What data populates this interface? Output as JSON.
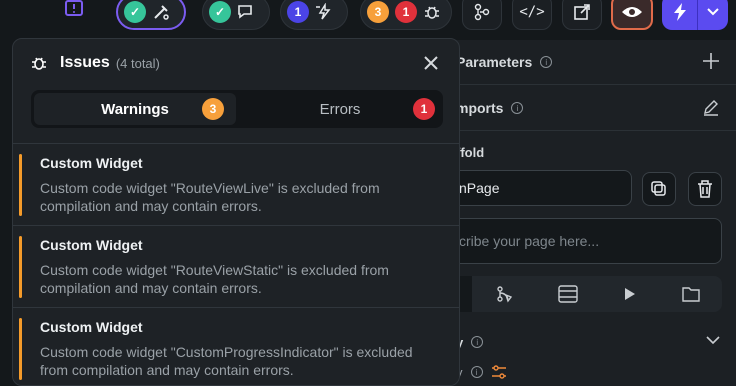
{
  "toolbar": {
    "pill_build": {
      "icons": [
        "check-icon",
        "magic-icon"
      ]
    },
    "pill_comments": {
      "icons": [
        "check-icon",
        "chat-icon"
      ]
    },
    "pill_actions": {
      "count": "1"
    },
    "pill_issues": {
      "warnings": "3",
      "errors": "1"
    }
  },
  "right_panel": {
    "parameters_label": "Parameters",
    "imports_label": "mports",
    "scaffold_label": "ffold",
    "page_name_value": "nPage",
    "describe_placeholder": "cribe your page here...",
    "bottom_label_1": "y",
    "bottom_label_2": "y"
  },
  "issues": {
    "title": "Issues",
    "count_label": "(4 total)",
    "tabs": [
      {
        "label": "Warnings",
        "badge": "3",
        "active": true
      },
      {
        "label": "Errors",
        "badge": "1",
        "active": false
      }
    ],
    "items": [
      {
        "title": "Custom Widget",
        "message": "Custom code widget \"RouteViewLive\" is excluded from compilation and may contain errors."
      },
      {
        "title": "Custom Widget",
        "message": "Custom code widget \"RouteViewStatic\" is excluded from compilation and may contain errors."
      },
      {
        "title": "Custom Widget",
        "message": "Custom code widget \"CustomProgressIndicator\" is excluded from compilation and may contain errors."
      }
    ]
  },
  "colors": {
    "accent_purple": "#7b5cf0",
    "warning": "#f7a03b",
    "error": "#e0313b",
    "success": "#36c59a",
    "primary_button": "#5b4bf0",
    "preview_button": "#e06b4a"
  }
}
